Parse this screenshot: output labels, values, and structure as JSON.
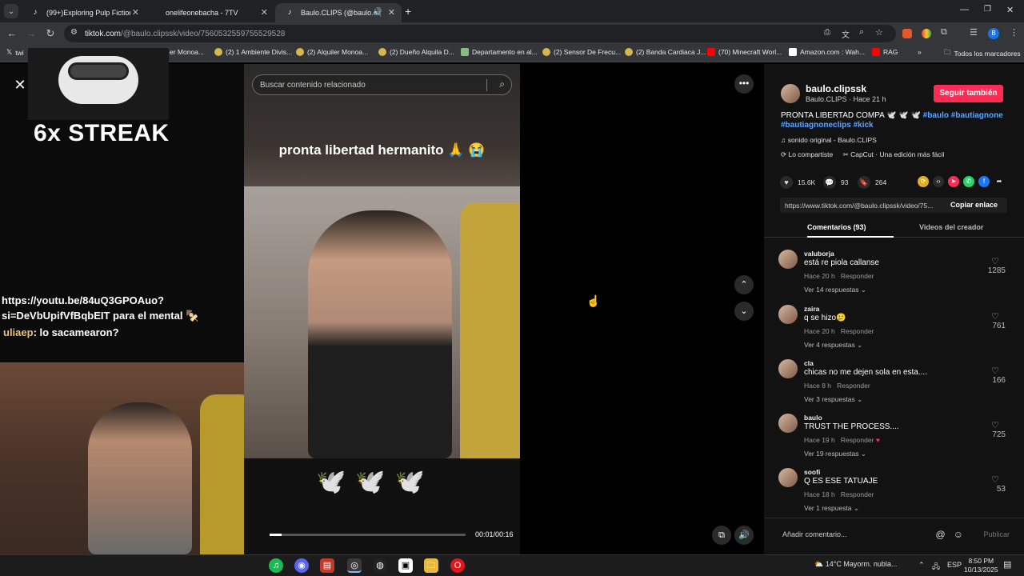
{
  "browser": {
    "tabs": [
      {
        "label": "(99+)Exploring Pulp Fiction Dan",
        "icon": "tiktok-icon",
        "active": false
      },
      {
        "label": "onelifeonebacha - 7TV",
        "icon": "",
        "active": false
      },
      {
        "label": "Baulo.CLIPS (@baulo.clipssk)",
        "icon": "tiktok-icon",
        "active": true
      }
    ],
    "url_host": "tiktok.com",
    "url_path": "/@baulo.clipssk/video/7560532559755529528",
    "bookmarks": [
      "twi",
      "er Monoa...",
      "(2) 1 Ambiente Divis...",
      "(2) Alquiler Monoa...",
      "(2) Dueño Alquila D...",
      "Departamento en al...",
      "(2) Sensor De Frecu...",
      "(2) Banda Cardiaca J...",
      "(70) Minecraft Worl...",
      "Amazon.com : Wah...",
      "RAG"
    ],
    "all_bookmarks": "Todos los marcadores",
    "profile_initial": "B"
  },
  "stream_overlay": {
    "streak": "6x STREAK",
    "yt_link_line1": "https://youtu.be/84uQ3GPOAuo?",
    "yt_link_line2": "si=DeVbUpifVfBqbEIT para el mental 🍢",
    "chat_user": "uliaep",
    "chat_message": ": lo sacamearon?"
  },
  "video": {
    "search_placeholder": "Buscar contenido relacionado",
    "caption": "pronta libertad hermanito 🙏 😭",
    "doves": "🕊️🕊️🕊️",
    "time": "00:01/00:16",
    "progress": 0.06
  },
  "creator": {
    "username": "baulo.clipssk",
    "display": "Baulo.CLIPS · Hace 21 h",
    "follow_label": "Seguir también",
    "desc_text": "PRONTA LIBERTAD COMPA 🕊️ 🕊️ 🕊️ ",
    "tags": [
      "#baulo",
      "#bautiagnone",
      "#bautiagnoneclips",
      "#kick"
    ],
    "sound": "sonido original - Baulo.CLIPS",
    "shared": "Lo compartiste",
    "capcut": "CapCut · Una edición más fácil",
    "likes": "15.6K",
    "comments": "93",
    "saves": "264",
    "link": "https://www.tiktok.com/@baulo.clipssk/video/75...",
    "copy_label": "Copiar enlace",
    "tab_comments": "Comentarios (93)",
    "tab_videos": "Videos del creador"
  },
  "comments": [
    {
      "user": "valuborja",
      "text": "está re piola callanse",
      "time": "Hace 20 h",
      "reply": "Responder",
      "more": "Ver 14 respuestas",
      "likes": "1285"
    },
    {
      "user": "zaira",
      "text": "q se hizo🥲",
      "time": "Hace 20 h",
      "reply": "Responder",
      "more": "Ver 4 respuestas",
      "likes": "761"
    },
    {
      "user": "cla",
      "text": "chicas no me dejen sola en esta....",
      "time": "Hace 8 h",
      "reply": "Responder",
      "more": "Ver 3 respuestas",
      "likes": "166"
    },
    {
      "user": "baulo",
      "text": "TRUST THE PROCESS....",
      "time": "Hace 19 h",
      "reply": "Responder",
      "more": "Ver 19 respuestas",
      "likes": "725"
    },
    {
      "user": "soofi",
      "text": "Q ES ESE TATUAJE",
      "time": "Hace 18 h",
      "reply": "Responder",
      "more": "Ver 1 respuesta",
      "likes": "53"
    }
  ],
  "comment_input": {
    "placeholder": "Añadir comentario...",
    "publish": "Publicar"
  },
  "taskbar": {
    "weather": "14°C  Mayorm. nubla...",
    "lang": "ESP",
    "time": "8:50 PM",
    "date": "10/13/2025"
  },
  "colors": {
    "accent": "#fe2c55",
    "hashtag": "#5ea5ff"
  }
}
